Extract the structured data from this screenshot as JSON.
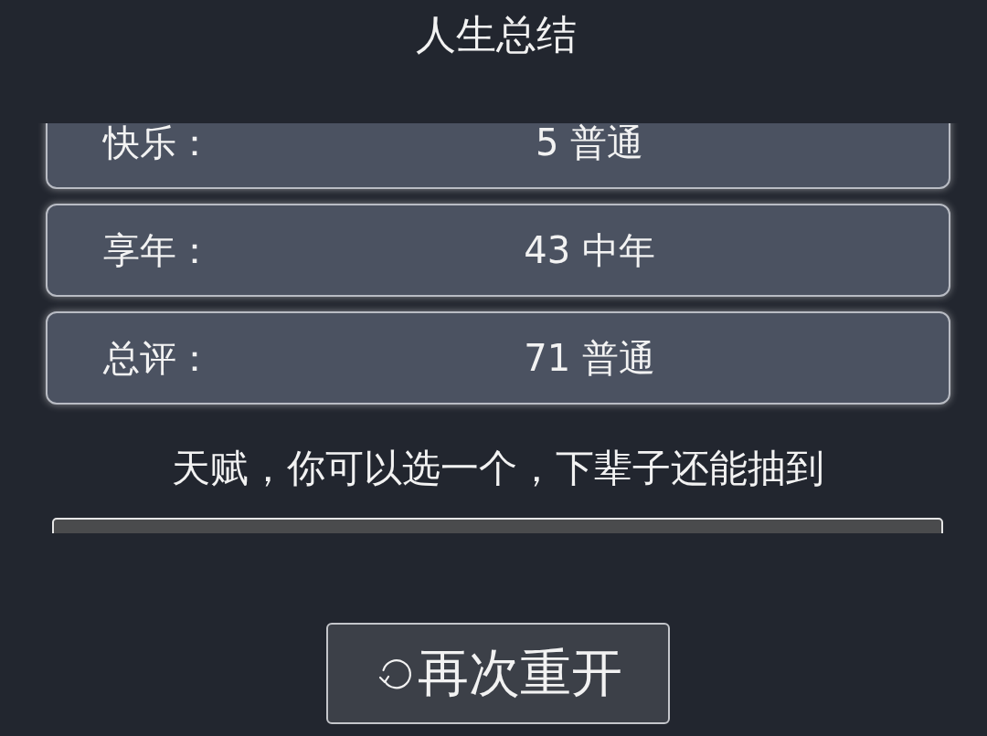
{
  "title": "人生总结",
  "summary": [
    {
      "label": "快乐：",
      "value": "5 普通"
    },
    {
      "label": "享年：",
      "value": "43 中年"
    },
    {
      "label": "总评：",
      "value": "71 普通"
    }
  ],
  "talent_prompt": "天赋，你可以选一个，下辈子还能抽到",
  "talent_options": [
    {
      "color": "#4a4b4d"
    }
  ],
  "restart_button": {
    "label": "再次重开"
  }
}
